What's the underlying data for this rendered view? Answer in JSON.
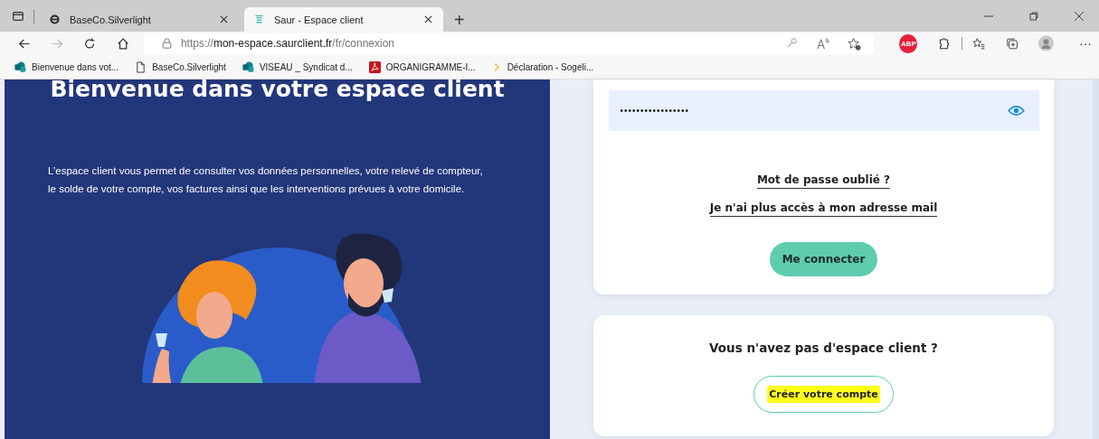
{
  "browser": {
    "tabs": [
      {
        "title": "BaseCo.Silverlight",
        "kind": "ie",
        "selected": false
      },
      {
        "title": "Saur - Espace client",
        "kind": "saur",
        "selected": true
      }
    ],
    "new_tab": "+",
    "url": {
      "scheme": "https://",
      "host": "mon-espace.saurclient.fr",
      "path": "/fr/connexion"
    },
    "bookmarks": [
      {
        "title": "Bienvenue dans vot...",
        "kind": "sharepoint"
      },
      {
        "title": "BaseCo.Silverlight",
        "kind": "page"
      },
      {
        "title": "VISEAU _ Syndicat d...",
        "kind": "sharepoint"
      },
      {
        "title": "ORGANIGRAMME-I...",
        "kind": "pdf"
      },
      {
        "title": "Déclaration - Sogeli...",
        "kind": "folder"
      }
    ],
    "extension_badge": "ABP",
    "more": "···"
  },
  "hero": {
    "title": "Bienvenue dans votre espace client",
    "text": "L’espace client vous permet de consulter vos données personnelles, votre relevé de compteur, le solde de votre compte, vos factures ainsi que les interventions prévues à votre domicile."
  },
  "login": {
    "password": {
      "value": "•••••••••••••••••"
    },
    "links": [
      "Mot de passe oublié ?",
      "Je n'ai plus accès à mon adresse mail"
    ],
    "submit": "Me connecter"
  },
  "signup": {
    "title": "Vous n'avez pas d'espace client ?",
    "button": {
      "label": "Créer votre compte",
      "highlighted": true
    }
  }
}
